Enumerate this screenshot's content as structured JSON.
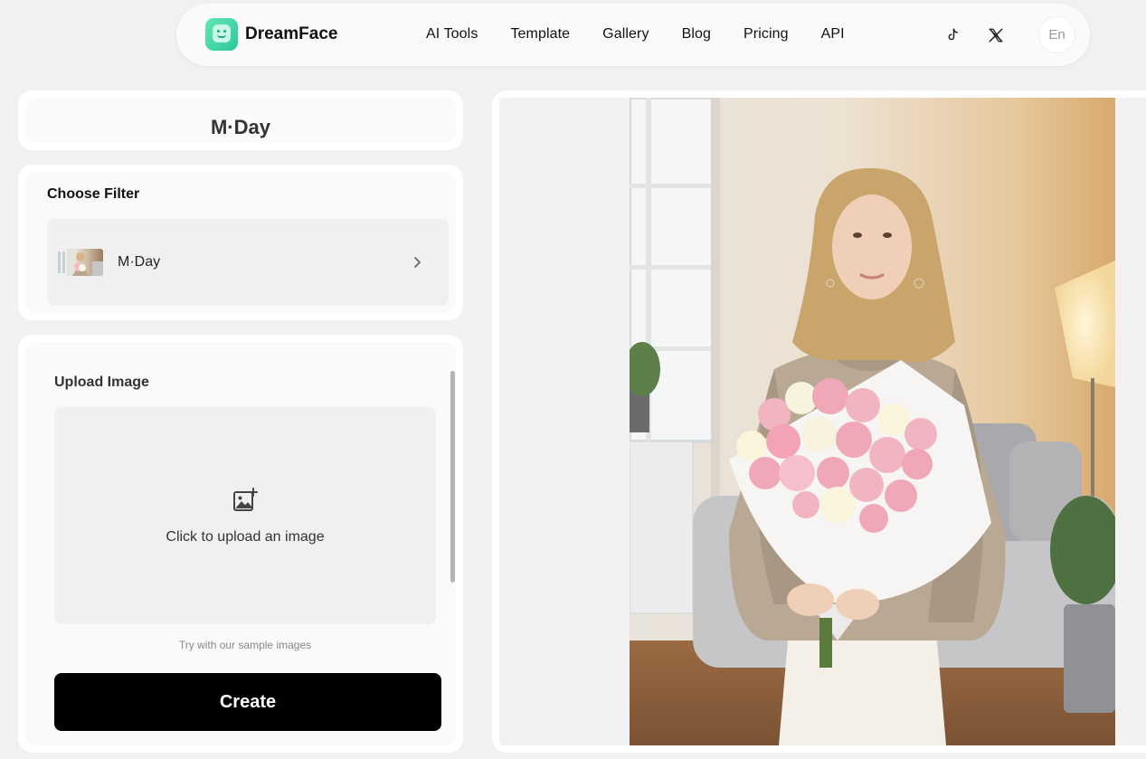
{
  "brand": {
    "name": "DreamFace"
  },
  "nav": {
    "items": [
      {
        "label": "AI Tools"
      },
      {
        "label": "Template"
      },
      {
        "label": "Gallery"
      },
      {
        "label": "Blog"
      },
      {
        "label": "Pricing"
      },
      {
        "label": "API"
      }
    ]
  },
  "social": {
    "icons": [
      "tiktok-icon",
      "x-icon"
    ]
  },
  "language": {
    "label": "En"
  },
  "page": {
    "title": "M·Day"
  },
  "filter": {
    "section_title": "Choose Filter",
    "selected": "M·Day"
  },
  "upload": {
    "section_title": "Upload Image",
    "dropzone_text": "Click to upload an image",
    "sample_text": "Try with our sample images",
    "create_label": "Create"
  },
  "colors": {
    "accent": "#2cc79a",
    "button": "#000000",
    "background": "#f1f1f1"
  }
}
